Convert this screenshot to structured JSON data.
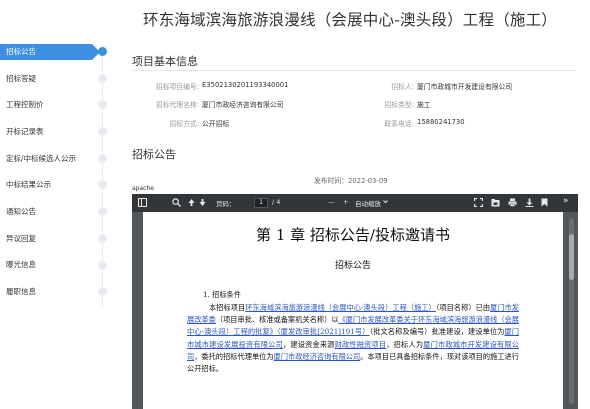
{
  "page": {
    "title": "环东海域滨海旅游浪漫线（会展中心-澳头段）工程（施工）"
  },
  "sidebar": {
    "items": [
      {
        "label": "招标公告",
        "active": true
      },
      {
        "label": "招标答疑",
        "active": false
      },
      {
        "label": "工程控制价",
        "active": false
      },
      {
        "label": "开标记录表",
        "active": false
      },
      {
        "label": "定标/中标候选人公示",
        "active": false
      },
      {
        "label": "中标结果公示",
        "active": false
      },
      {
        "label": "通知公告",
        "active": false
      },
      {
        "label": "异议回复",
        "active": false
      },
      {
        "label": "曝光信息",
        "active": false
      },
      {
        "label": "履职信息",
        "active": false
      }
    ]
  },
  "basic_info": {
    "section_title": "项目基本信息",
    "project_no_label": "招标项目编号:",
    "project_no": "E3502130201193340001",
    "tenderer_label": "招标人:",
    "tenderer": "厦门市政城市开发建设有限公司",
    "agency_label": "招标代理名称:",
    "agency": "厦门市政经济咨询有限公司",
    "type_label": "招标类型:",
    "type": "施工",
    "method_label": "招标方式:",
    "method": "公开招标",
    "phone_label": "联系电话:",
    "phone": "15880241730"
  },
  "announcement": {
    "section_title": "招标公告",
    "publish_time": "发布时间：2022-03-09",
    "viewer_label": "apache"
  },
  "pdf_viewer": {
    "page_prefix": "页码：",
    "page_current": "1",
    "page_total": "/ 4",
    "zoom_minus": "—",
    "zoom_plus": "+",
    "zoom_label": "自动缩放",
    "more": "»",
    "icons": [
      "sidebar-toggle-icon",
      "search-icon",
      "previous-page-icon",
      "next-page-icon",
      "fullscreen-icon",
      "open-file-icon",
      "print-icon",
      "download-icon",
      "bookmark-icon"
    ]
  },
  "document": {
    "chapter_title": "第 1 章 招标公告/投标邀请书",
    "subtitle": "招标公告",
    "section_heading": "1. 招标条件",
    "p1": "本招标项目",
    "p1_link": "环东海域滨海旅游浪漫线（会展中心-澳头段）工程（施工）",
    "p2": "（项目名称）已由",
    "p2_link": "厦门市发展改革委",
    "p3": "（项目审批、核准或备案机关名称）以",
    "p3_link": "《厦门市发展改革委关于环东海域滨海旅游浪漫线（会展中心-澳头段）工程的批复》（厦发改审批[2021]191号）",
    "p4": "（批文名称及编号）批准建设，建设单位为",
    "p4_link": "厦门市城市建设发展投资有限公司",
    "p5": "，建设资金来源",
    "p5_link": "财政性融资项目",
    "p6": "，招标人为",
    "p6_link": "厦门市政城市开发建设有限公司",
    "p7": "，委托的招标代理单位为",
    "p7_link": "厦门市政经济咨询有限公司",
    "p8": "。本项目已具备招标条件，现对该项目的施工进行公开招标。"
  },
  "colors": {
    "accent": "#3d8fe4",
    "link": "#2b56c9",
    "toolbar": "#323639",
    "viewer_bg": "#525659"
  }
}
